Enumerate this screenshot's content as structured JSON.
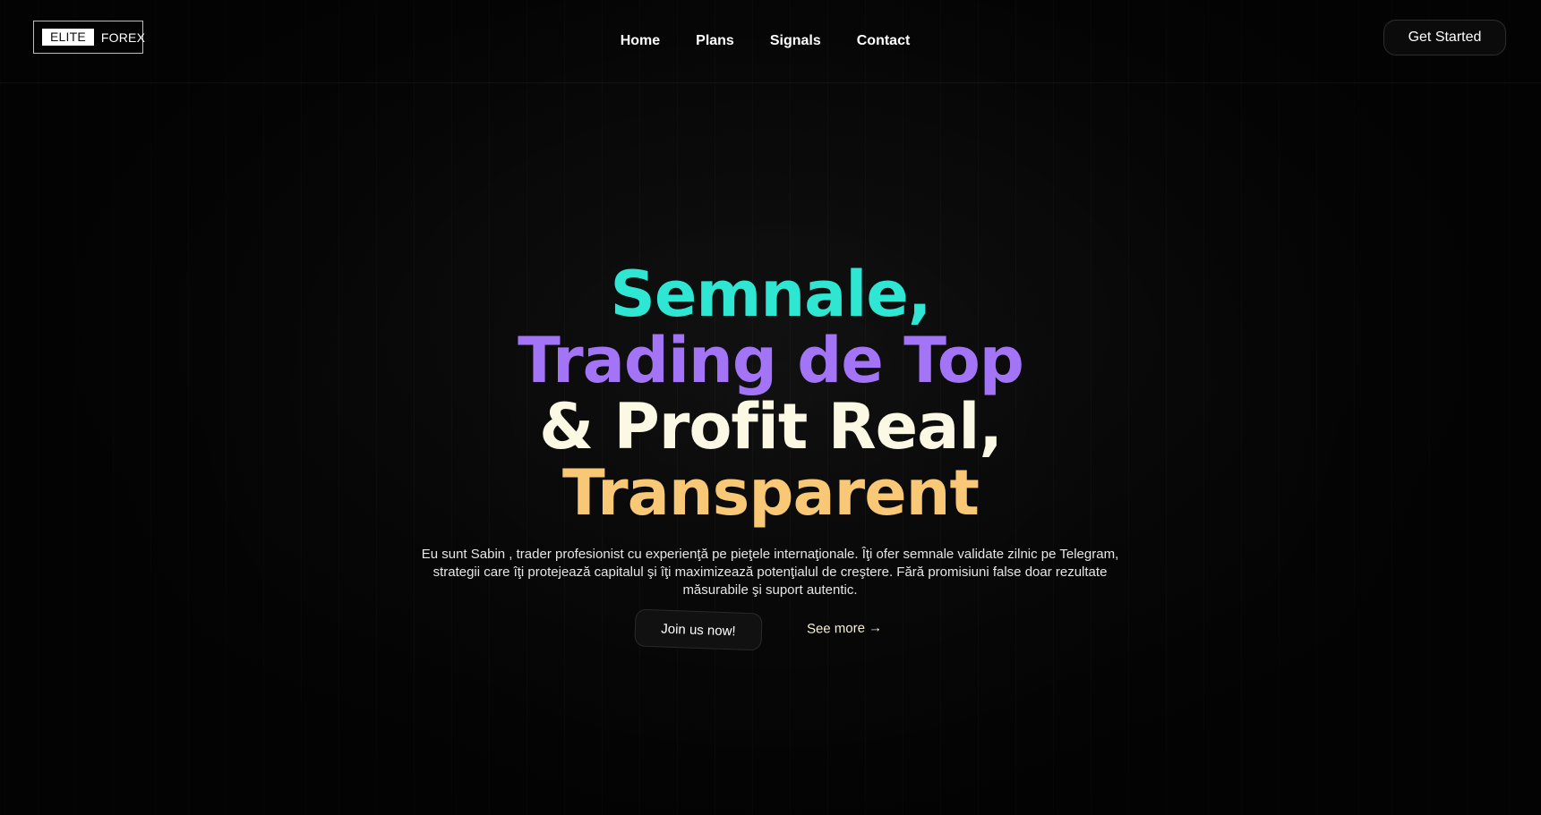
{
  "logo": {
    "part1": "ELITE",
    "part2": "FOREX"
  },
  "nav": {
    "items": [
      {
        "label": "Home"
      },
      {
        "label": "Plans"
      },
      {
        "label": "Signals"
      },
      {
        "label": "Contact"
      }
    ]
  },
  "header": {
    "cta_label": "Get Started"
  },
  "hero": {
    "title_lines": [
      {
        "text": "Semnale,",
        "color": "#2ee6d1"
      },
      {
        "text": "Trading de Top",
        "color": "#a474f6"
      },
      {
        "text": "& Profit Real,",
        "color": "#fbf9e4"
      },
      {
        "text": "Transparent",
        "color": "#f9c876"
      }
    ],
    "description": "Eu sunt Sabin , trader profesionist cu experienţă pe pieţele internaţionale. Îţi ofer semnale validate zilnic pe Telegram, strategii care îţi protejează capitalul şi îţi maximizează potenţialul de creştere. Fără promisiuni false doar rezultate măsurabile şi suport autentic.",
    "primary_button": "Join us now!",
    "secondary_link": "See more",
    "secondary_icon": "arrow-right-icon"
  },
  "colors": {
    "background": "#080808",
    "accent_teal": "#2ee6d1",
    "accent_purple": "#a474f6",
    "accent_cream": "#fbf9e4",
    "accent_gold": "#f9c876"
  }
}
